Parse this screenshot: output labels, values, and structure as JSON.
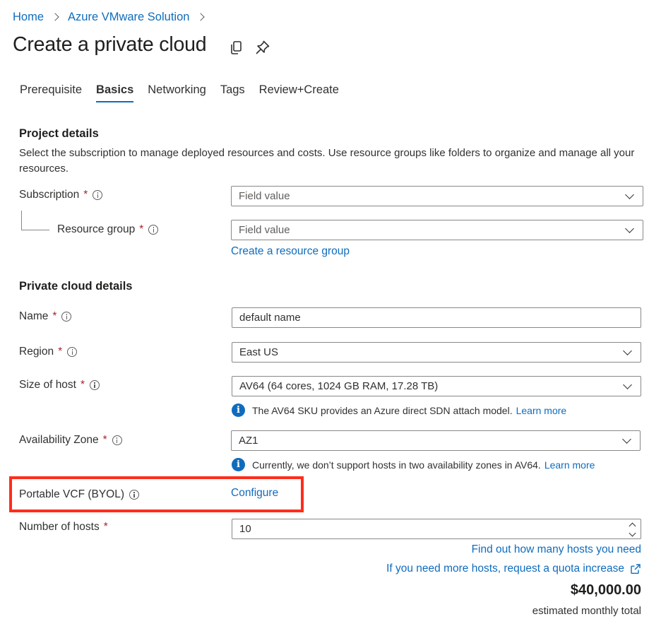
{
  "breadcrumb": {
    "home": "Home",
    "service": "Azure VMware Solution"
  },
  "page": {
    "title": "Create a private cloud"
  },
  "tabs": [
    "Prerequisite",
    "Basics",
    "Networking",
    "Tags",
    "Review+Create"
  ],
  "project": {
    "heading": "Project details",
    "description": "Select the subscription to manage deployed resources and costs. Use resource groups like folders to organize and manage all your resources.",
    "subscription_label": "Subscription",
    "subscription_value": "Field value",
    "resource_group_label": "Resource group",
    "resource_group_value": "Field value",
    "create_rg_link": "Create a resource group"
  },
  "cloud": {
    "heading": "Private cloud details",
    "name_label": "Name",
    "name_value": "default name",
    "region_label": "Region",
    "region_value": "East US",
    "size_label": "Size of host",
    "size_value": "AV64 (64 cores, 1024 GB RAM, 17.28 TB)",
    "size_note": "The AV64 SKU provides an Azure direct SDN attach model.",
    "size_note_link": "Learn more",
    "az_label": "Availability Zone",
    "az_value": "AZ1",
    "az_note": "Currently, we don’t support hosts in two availability zones in AV64.",
    "az_note_link": "Learn more",
    "vcf_label": "Portable VCF (BYOL)",
    "vcf_link": "Configure",
    "hosts_label": "Number of hosts",
    "hosts_value": "10",
    "find_hosts_link": "Find out how many hosts you need",
    "quota_link": "If you need more hosts, request a quota increase",
    "price": "$40,000.00",
    "price_sub": "estimated monthly total"
  },
  "required_mark": "*",
  "icons": {
    "copy": "copy-icon",
    "pin": "pin-icon",
    "info": "info-icon",
    "external": "external-link-icon"
  },
  "colors": {
    "accent": "#0f6cbd",
    "highlight": "#ff2d1a",
    "required": "#a4262c"
  }
}
